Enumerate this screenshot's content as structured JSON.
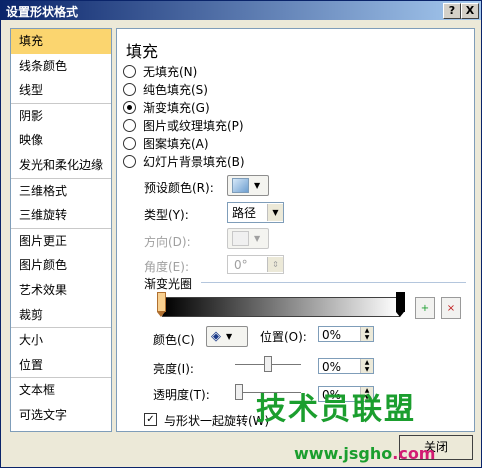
{
  "window": {
    "title": "设置形状格式",
    "help_label": "?",
    "close_label": "X"
  },
  "sidebar": {
    "items": [
      {
        "label": "填充",
        "selected": true
      },
      {
        "label": "线条颜色"
      },
      {
        "label": "线型"
      },
      {
        "label": "阴影"
      },
      {
        "label": "映像"
      },
      {
        "label": "发光和柔化边缘"
      },
      {
        "label": "三维格式"
      },
      {
        "label": "三维旋转"
      },
      {
        "label": "图片更正"
      },
      {
        "label": "图片颜色"
      },
      {
        "label": "艺术效果"
      },
      {
        "label": "裁剪"
      },
      {
        "label": "大小"
      },
      {
        "label": "位置"
      },
      {
        "label": "文本框"
      },
      {
        "label": "可选文字"
      }
    ]
  },
  "panel": {
    "title": "填充",
    "fill_options": [
      {
        "label": "无填充(N)",
        "checked": false
      },
      {
        "label": "纯色填充(S)",
        "checked": false
      },
      {
        "label": "渐变填充(G)",
        "checked": true
      },
      {
        "label": "图片或纹理填充(P)",
        "checked": false
      },
      {
        "label": "图案填充(A)",
        "checked": false
      },
      {
        "label": "幻灯片背景填充(B)",
        "checked": false
      }
    ],
    "preset_colors_label": "预设颜色(R):",
    "type_label": "类型(Y):",
    "type_value": "路径",
    "direction_label": "方向(D):",
    "angle_label": "角度(E):",
    "angle_value": "0°",
    "gradient_stops_label": "渐变光圈",
    "color_label": "颜色(C)",
    "position_label": "位置(O):",
    "position_value": "0%",
    "brightness_label": "亮度(I):",
    "brightness_value": "0%",
    "brightness_level": 0.5,
    "transparency_label": "透明度(T):",
    "transparency_value": "0%",
    "transparency_level": 0.0,
    "rotate_with_shape_label": "与形状一起旋转(W)",
    "rotate_with_shape_checked": true
  },
  "footer": {
    "close_label": "关闭"
  },
  "watermark": {
    "main": "技术员联盟",
    "url_prefix": "www.jsgho",
    "url_suffix": ".com"
  },
  "colors": {
    "selected_item": "#fbd56f",
    "title_bar": "#0a246a",
    "watermark_green": "#1b9e2e",
    "watermark_pink": "#d21b73"
  }
}
